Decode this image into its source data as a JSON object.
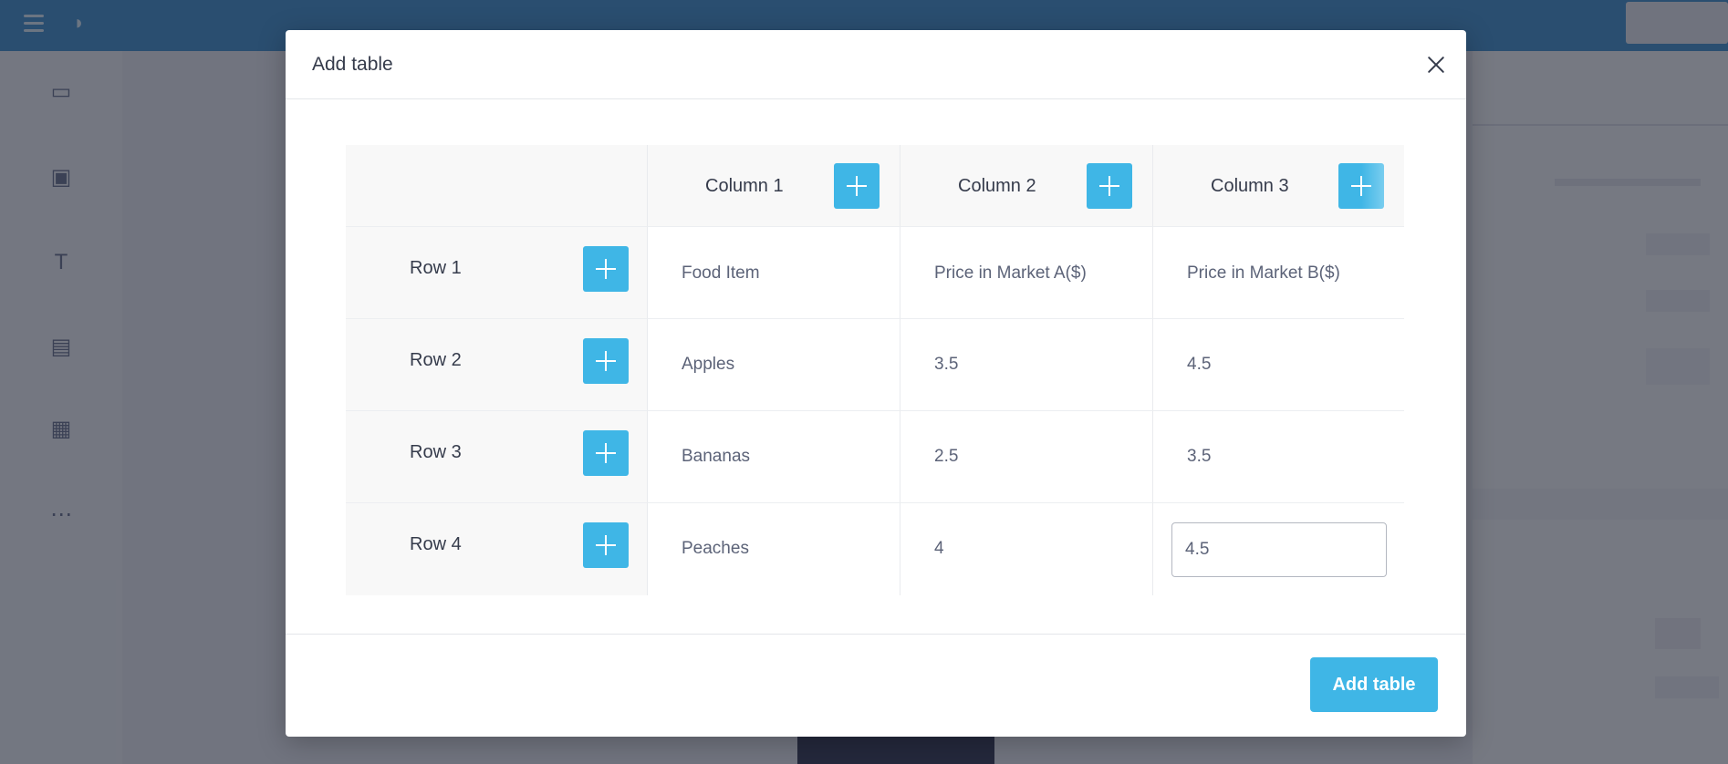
{
  "modal": {
    "title": "Add table",
    "submit_label": "Add table"
  },
  "table": {
    "columns": [
      "Column 1",
      "Column 2",
      "Column 3"
    ],
    "rows": [
      {
        "label": "Row 1",
        "cells": [
          "Food Item",
          "Price in Market A($)",
          "Price in Market B($)"
        ]
      },
      {
        "label": "Row 2",
        "cells": [
          "Apples",
          "3.5",
          "4.5"
        ]
      },
      {
        "label": "Row 3",
        "cells": [
          "Bananas",
          "2.5",
          "3.5"
        ]
      },
      {
        "label": "Row 4",
        "cells": [
          "Peaches",
          "4",
          "4.5"
        ]
      }
    ]
  },
  "icons": {
    "close": "close-icon",
    "add_column": "plus-icon",
    "add_row": "plus-icon"
  },
  "colors": {
    "accent": "#3fb6e6",
    "header_background": "#f8f8f8",
    "overlay": "#282c3a"
  }
}
